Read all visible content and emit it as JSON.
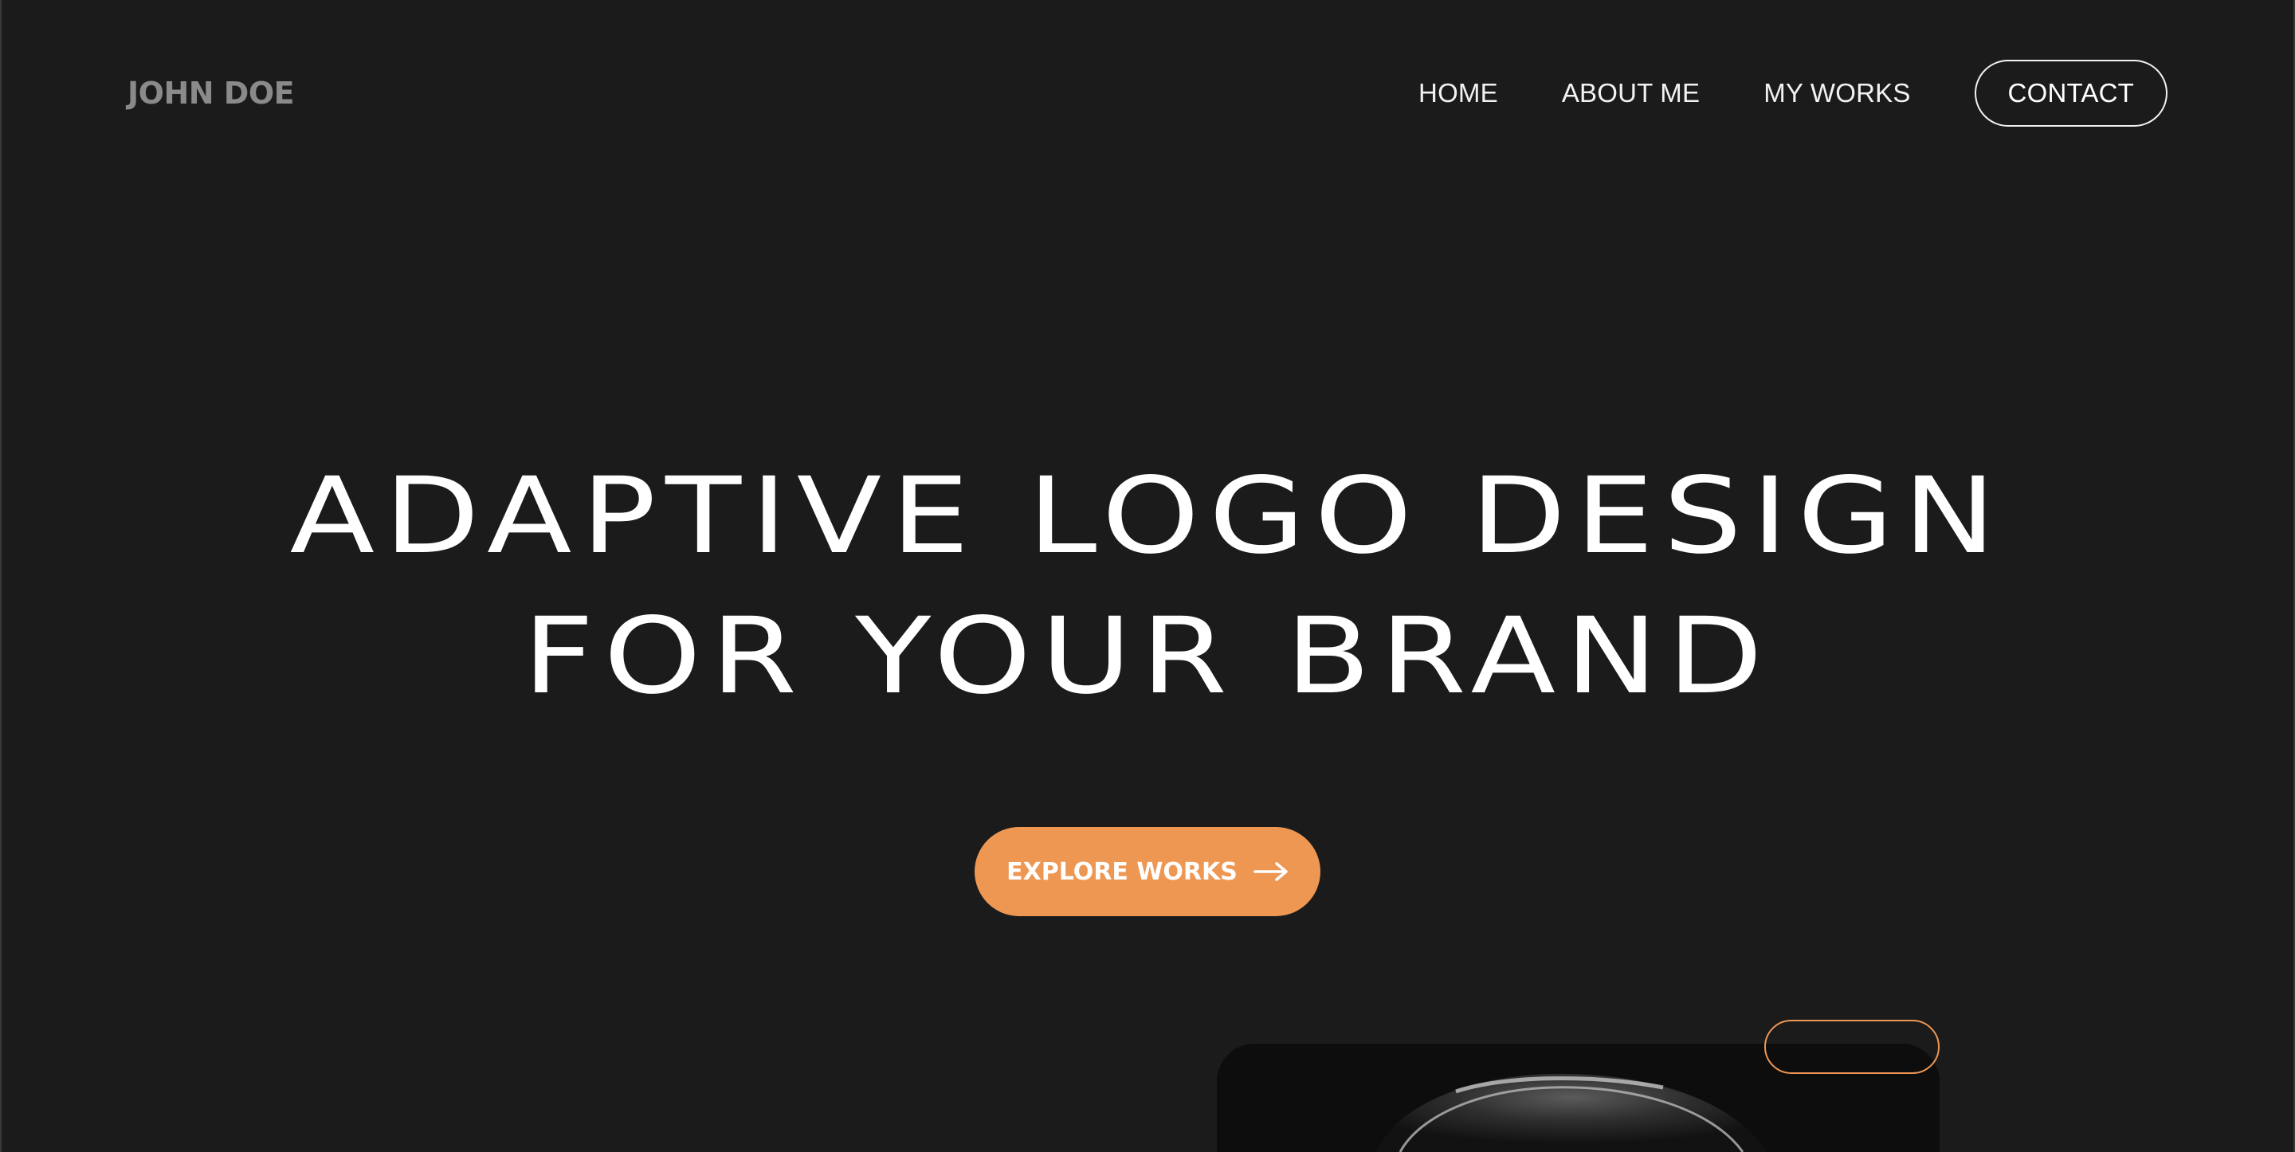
{
  "header": {
    "brand": "JOHN DOE",
    "nav": [
      {
        "label": "HOME"
      },
      {
        "label": "ABOUT ME"
      },
      {
        "label": "MY WORKS"
      }
    ],
    "contact_label": "CONTACT"
  },
  "hero": {
    "title_line_1": "ADAPTIVE LOGO DESIGN",
    "title_line_2": "FOR YOUR BRAND",
    "cta_label": "EXPLORE WORKS",
    "cta_icon": "arrow-right-icon"
  },
  "colors": {
    "background": "#1b1b1b",
    "accent": "#ee9753",
    "text": "#ffffff",
    "brand_text": "#8a8a8a"
  }
}
